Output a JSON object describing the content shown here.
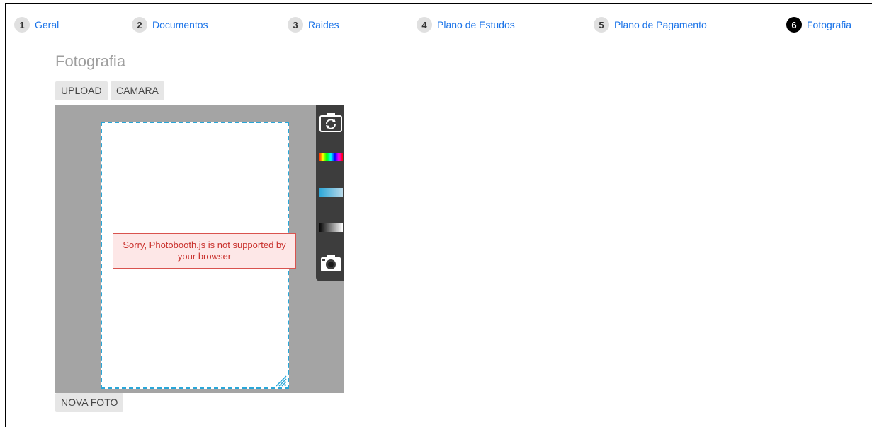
{
  "stepper": {
    "steps": [
      {
        "number": "1",
        "label": "Geral"
      },
      {
        "number": "2",
        "label": "Documentos"
      },
      {
        "number": "3",
        "label": "Raides"
      },
      {
        "number": "4",
        "label": "Plano de Estudos"
      },
      {
        "number": "5",
        "label": "Plano de Pagamento"
      },
      {
        "number": "6",
        "label": "Fotografia"
      }
    ],
    "active_step": "6"
  },
  "section": {
    "title": "Fotografia",
    "upload_label": "UPLOAD",
    "camera_label": "CAMARA"
  },
  "photobooth": {
    "error_message": "Sorry, Photobooth.js is not supported by your browser",
    "tools": [
      "camera-switch-icon",
      "hue-icon",
      "saturation-icon",
      "brightness-icon",
      "take-photo-icon"
    ]
  },
  "new_photo_label": "NOVA FOTO",
  "colors": {
    "link": "#1a73e8",
    "active_step": "#000000",
    "crop_border": "#29a6d8",
    "error_text": "#c9302c",
    "error_bg": "#fde7e7"
  }
}
